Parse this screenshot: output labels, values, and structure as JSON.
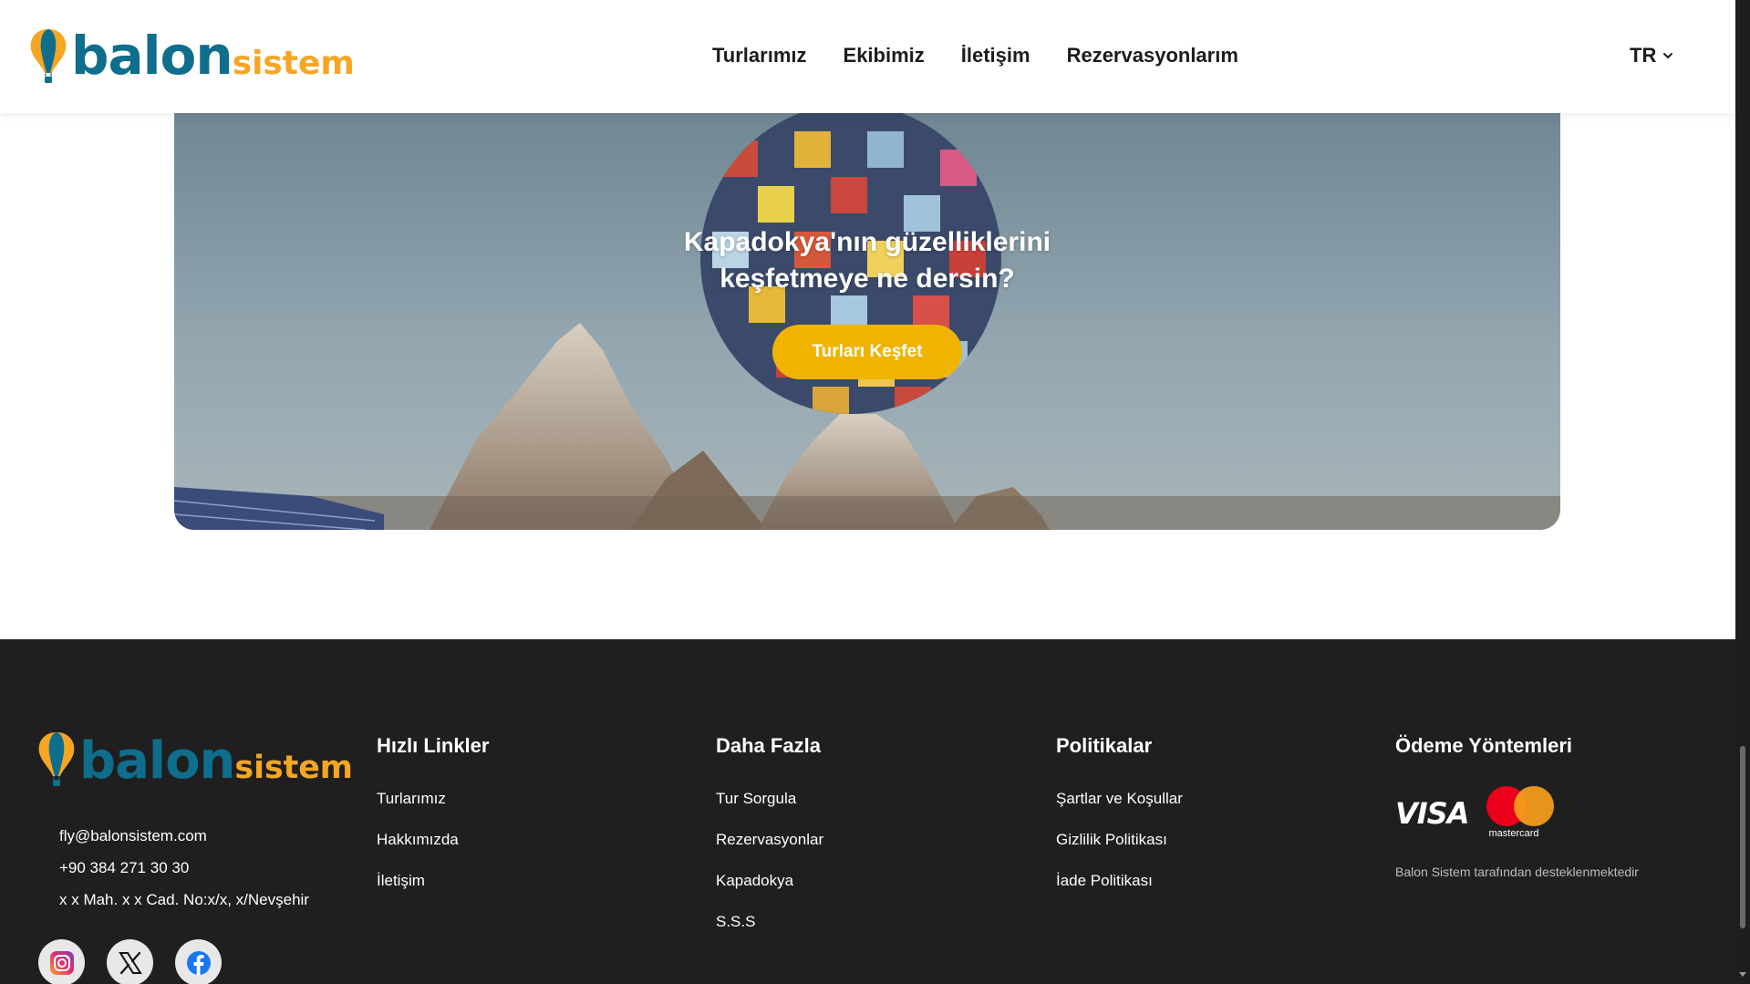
{
  "brand": {
    "name_part1": "balon",
    "name_part2": "sistem"
  },
  "nav": {
    "items": [
      {
        "label": "Turlarımız"
      },
      {
        "label": "Ekibimiz"
      },
      {
        "label": "İletişim"
      },
      {
        "label": "Rezervasyonlarım"
      }
    ],
    "language": "TR"
  },
  "hero": {
    "title_line1": "Kapadokya'nın güzelliklerini",
    "title_line2": "keşfetmeye ne dersin?",
    "button_label": "Turları Keşfet"
  },
  "footer": {
    "contact": {
      "email": "fly@balonsistem.com",
      "phone": "+90 384 271 30 30",
      "address": "x x Mah. x x Cad. No:x/x, x/Nevşehir"
    },
    "socials": [
      "instagram-icon",
      "x-icon",
      "facebook-icon"
    ],
    "quick_links": {
      "title": "Hızlı Linkler",
      "items": [
        "Turlarımız",
        "Hakkımızda",
        "İletişim"
      ]
    },
    "more": {
      "title": "Daha Fazla",
      "items": [
        "Tur Sorgula",
        "Rezervasyonlar",
        "Kapadokya",
        "S.S.S"
      ]
    },
    "policies": {
      "title": "Politikalar",
      "items": [
        "Şartlar ve Koşullar",
        "Gizlilik Politikası",
        "İade Politikası"
      ]
    },
    "payment": {
      "title": "Ödeme Yöntemleri",
      "methods": [
        "VISA",
        "mastercard"
      ],
      "support_text": "Balon Sistem tarafından desteklenmektedir"
    }
  },
  "colors": {
    "accent": "#f0b400",
    "brand_blue": "#0e6e8c",
    "brand_orange": "#f5a623",
    "footer_bg": "#1f1f1f"
  }
}
